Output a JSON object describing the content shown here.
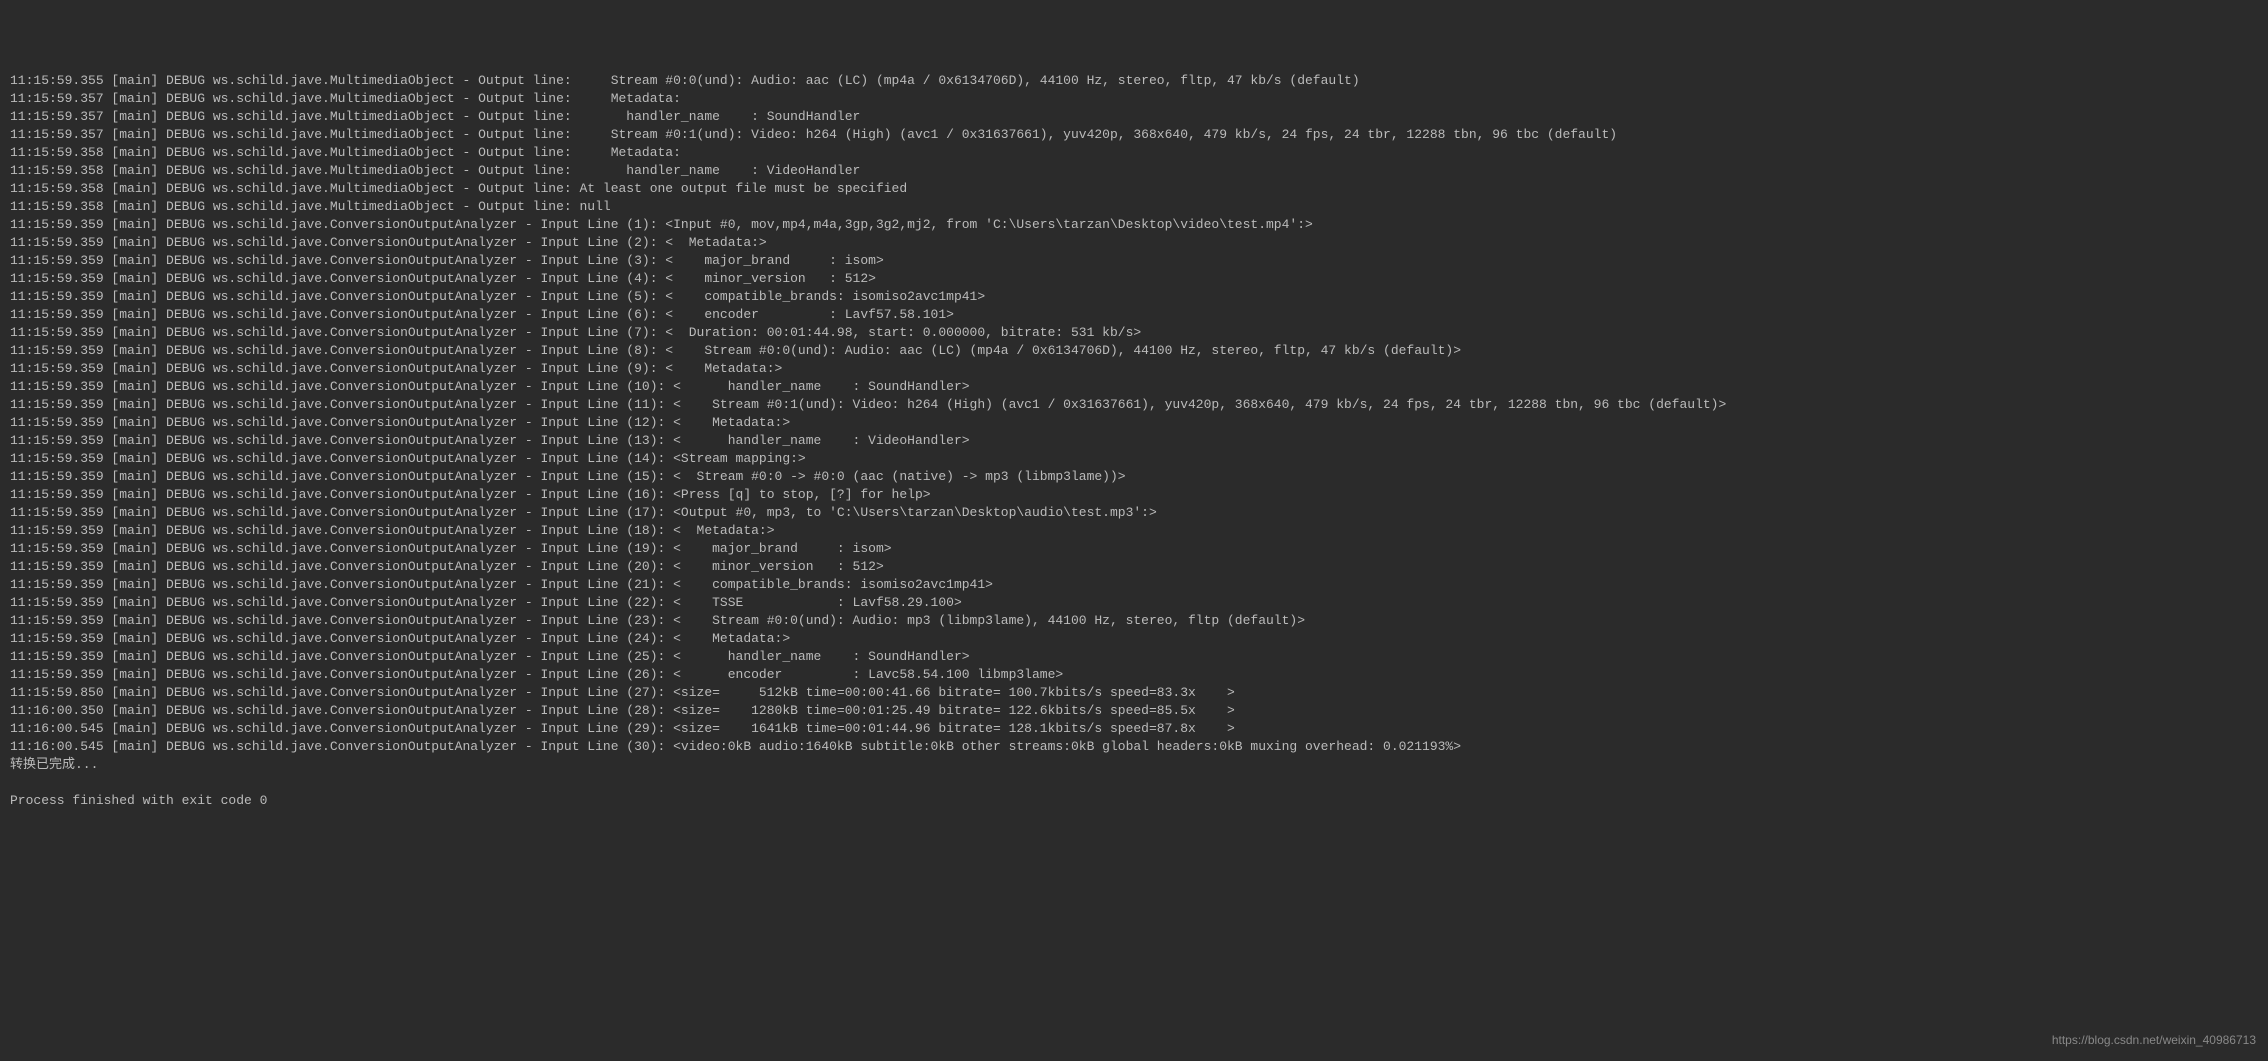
{
  "lines": [
    "11:15:59.355 [main] DEBUG ws.schild.jave.MultimediaObject - Output line:     Stream #0:0(und): Audio: aac (LC) (mp4a / 0x6134706D), 44100 Hz, stereo, fltp, 47 kb/s (default)",
    "11:15:59.357 [main] DEBUG ws.schild.jave.MultimediaObject - Output line:     Metadata:",
    "11:15:59.357 [main] DEBUG ws.schild.jave.MultimediaObject - Output line:       handler_name    : SoundHandler",
    "11:15:59.357 [main] DEBUG ws.schild.jave.MultimediaObject - Output line:     Stream #0:1(und): Video: h264 (High) (avc1 / 0x31637661), yuv420p, 368x640, 479 kb/s, 24 fps, 24 tbr, 12288 tbn, 96 tbc (default)",
    "11:15:59.358 [main] DEBUG ws.schild.jave.MultimediaObject - Output line:     Metadata:",
    "11:15:59.358 [main] DEBUG ws.schild.jave.MultimediaObject - Output line:       handler_name    : VideoHandler",
    "11:15:59.358 [main] DEBUG ws.schild.jave.MultimediaObject - Output line: At least one output file must be specified",
    "11:15:59.358 [main] DEBUG ws.schild.jave.MultimediaObject - Output line: null",
    "11:15:59.359 [main] DEBUG ws.schild.jave.ConversionOutputAnalyzer - Input Line (1): <Input #0, mov,mp4,m4a,3gp,3g2,mj2, from 'C:\\Users\\tarzan\\Desktop\\video\\test.mp4':>",
    "11:15:59.359 [main] DEBUG ws.schild.jave.ConversionOutputAnalyzer - Input Line (2): <  Metadata:>",
    "11:15:59.359 [main] DEBUG ws.schild.jave.ConversionOutputAnalyzer - Input Line (3): <    major_brand     : isom>",
    "11:15:59.359 [main] DEBUG ws.schild.jave.ConversionOutputAnalyzer - Input Line (4): <    minor_version   : 512>",
    "11:15:59.359 [main] DEBUG ws.schild.jave.ConversionOutputAnalyzer - Input Line (5): <    compatible_brands: isomiso2avc1mp41>",
    "11:15:59.359 [main] DEBUG ws.schild.jave.ConversionOutputAnalyzer - Input Line (6): <    encoder         : Lavf57.58.101>",
    "11:15:59.359 [main] DEBUG ws.schild.jave.ConversionOutputAnalyzer - Input Line (7): <  Duration: 00:01:44.98, start: 0.000000, bitrate: 531 kb/s>",
    "11:15:59.359 [main] DEBUG ws.schild.jave.ConversionOutputAnalyzer - Input Line (8): <    Stream #0:0(und): Audio: aac (LC) (mp4a / 0x6134706D), 44100 Hz, stereo, fltp, 47 kb/s (default)>",
    "11:15:59.359 [main] DEBUG ws.schild.jave.ConversionOutputAnalyzer - Input Line (9): <    Metadata:>",
    "11:15:59.359 [main] DEBUG ws.schild.jave.ConversionOutputAnalyzer - Input Line (10): <      handler_name    : SoundHandler>",
    "11:15:59.359 [main] DEBUG ws.schild.jave.ConversionOutputAnalyzer - Input Line (11): <    Stream #0:1(und): Video: h264 (High) (avc1 / 0x31637661), yuv420p, 368x640, 479 kb/s, 24 fps, 24 tbr, 12288 tbn, 96 tbc (default)>",
    "11:15:59.359 [main] DEBUG ws.schild.jave.ConversionOutputAnalyzer - Input Line (12): <    Metadata:>",
    "11:15:59.359 [main] DEBUG ws.schild.jave.ConversionOutputAnalyzer - Input Line (13): <      handler_name    : VideoHandler>",
    "11:15:59.359 [main] DEBUG ws.schild.jave.ConversionOutputAnalyzer - Input Line (14): <Stream mapping:>",
    "11:15:59.359 [main] DEBUG ws.schild.jave.ConversionOutputAnalyzer - Input Line (15): <  Stream #0:0 -> #0:0 (aac (native) -> mp3 (libmp3lame))>",
    "11:15:59.359 [main] DEBUG ws.schild.jave.ConversionOutputAnalyzer - Input Line (16): <Press [q] to stop, [?] for help>",
    "11:15:59.359 [main] DEBUG ws.schild.jave.ConversionOutputAnalyzer - Input Line (17): <Output #0, mp3, to 'C:\\Users\\tarzan\\Desktop\\audio\\test.mp3':>",
    "11:15:59.359 [main] DEBUG ws.schild.jave.ConversionOutputAnalyzer - Input Line (18): <  Metadata:>",
    "11:15:59.359 [main] DEBUG ws.schild.jave.ConversionOutputAnalyzer - Input Line (19): <    major_brand     : isom>",
    "11:15:59.359 [main] DEBUG ws.schild.jave.ConversionOutputAnalyzer - Input Line (20): <    minor_version   : 512>",
    "11:15:59.359 [main] DEBUG ws.schild.jave.ConversionOutputAnalyzer - Input Line (21): <    compatible_brands: isomiso2avc1mp41>",
    "11:15:59.359 [main] DEBUG ws.schild.jave.ConversionOutputAnalyzer - Input Line (22): <    TSSE            : Lavf58.29.100>",
    "11:15:59.359 [main] DEBUG ws.schild.jave.ConversionOutputAnalyzer - Input Line (23): <    Stream #0:0(und): Audio: mp3 (libmp3lame), 44100 Hz, stereo, fltp (default)>",
    "11:15:59.359 [main] DEBUG ws.schild.jave.ConversionOutputAnalyzer - Input Line (24): <    Metadata:>",
    "11:15:59.359 [main] DEBUG ws.schild.jave.ConversionOutputAnalyzer - Input Line (25): <      handler_name    : SoundHandler>",
    "11:15:59.359 [main] DEBUG ws.schild.jave.ConversionOutputAnalyzer - Input Line (26): <      encoder         : Lavc58.54.100 libmp3lame>",
    "11:15:59.850 [main] DEBUG ws.schild.jave.ConversionOutputAnalyzer - Input Line (27): <size=     512kB time=00:00:41.66 bitrate= 100.7kbits/s speed=83.3x    >",
    "11:16:00.350 [main] DEBUG ws.schild.jave.ConversionOutputAnalyzer - Input Line (28): <size=    1280kB time=00:01:25.49 bitrate= 122.6kbits/s speed=85.5x    >",
    "11:16:00.545 [main] DEBUG ws.schild.jave.ConversionOutputAnalyzer - Input Line (29): <size=    1641kB time=00:01:44.96 bitrate= 128.1kbits/s speed=87.8x    >",
    "11:16:00.545 [main] DEBUG ws.schild.jave.ConversionOutputAnalyzer - Input Line (30): <video:0kB audio:1640kB subtitle:0kB other streams:0kB global headers:0kB muxing overhead: 0.021193%>",
    "转换已完成...",
    "",
    "Process finished with exit code 0"
  ],
  "watermark": "https://blog.csdn.net/weixin_40986713"
}
